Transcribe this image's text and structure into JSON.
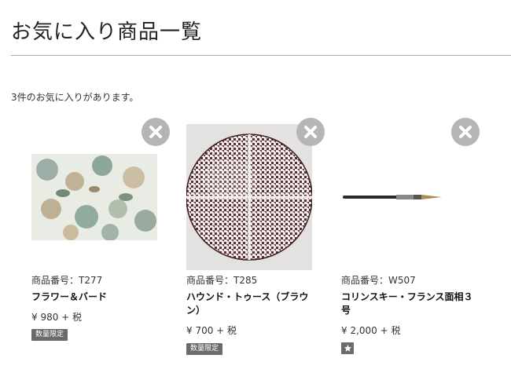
{
  "page": {
    "title": "お気に入り商品一覧",
    "count_text": "3件のお気に入りがあります。"
  },
  "products": [
    {
      "code": "商品番号：T277",
      "name": "フラワー＆バード",
      "price": "¥ 980 + 税",
      "badge": "数量限定",
      "image_icon": "floral-bird-tile-pattern"
    },
    {
      "code": "商品番号：T285",
      "name": "ハウンド・トゥース（ブラウン）",
      "price": "¥ 700 + 税",
      "badge": "数量限定",
      "image_icon": "houndstooth-plate"
    },
    {
      "code": "商品番号：W507",
      "name": "コリンスキー・フランス面相３号",
      "price": "¥ 2,000 + 税",
      "badge_icon": "star-icon",
      "image_icon": "paint-brush"
    }
  ],
  "colors": {
    "remove_button": "#b5b5b5",
    "badge_bg": "#6b6b6b",
    "divider": "#a8a8a8"
  }
}
